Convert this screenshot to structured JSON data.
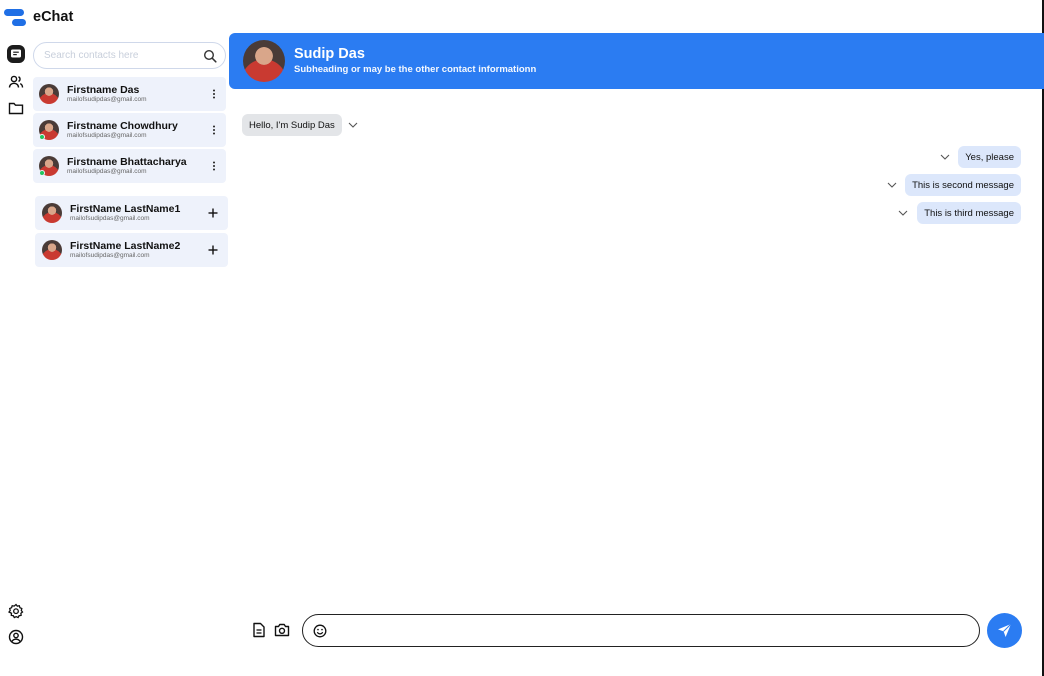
{
  "app": {
    "name": "eChat",
    "accent_color": "#2b7cf2",
    "online_color": "#22c55e"
  },
  "rail": {
    "top_icons": [
      "chat-icon",
      "users-icon",
      "folder-icon"
    ],
    "bottom_icons": [
      "settings-icon",
      "profile-icon"
    ]
  },
  "search": {
    "placeholder": "Search contacts here",
    "value": ""
  },
  "chats": [
    {
      "name": "Firstname Das",
      "email": "mailofsudipdas@gmail.com",
      "online": false
    },
    {
      "name": "Firstname Chowdhury",
      "email": "mailofsudipdas@gmail.com",
      "online": true
    },
    {
      "name": "Firstname Bhattacharya",
      "email": "mailofsudipdas@gmail.com",
      "online": true
    }
  ],
  "suggestions": [
    {
      "name": "FirstName LastName1",
      "email": "mailofsudipdas@gmail.com"
    },
    {
      "name": "FirstName LastName2",
      "email": "mailofsudipdas@gmail.com"
    }
  ],
  "header": {
    "title": "Sudip Das",
    "subtitle": "Subheading or may be the other contact informationn"
  },
  "messages": [
    {
      "direction": "in",
      "text": "Hello, I'm Sudip Das"
    },
    {
      "direction": "out",
      "text": "Yes, please"
    },
    {
      "direction": "out",
      "text": "This is second message"
    },
    {
      "direction": "out",
      "text": "This is third message"
    }
  ],
  "composer": {
    "placeholder": "",
    "value": "",
    "icons": [
      "document-icon",
      "camera-icon",
      "emoji-icon",
      "send-icon"
    ]
  }
}
